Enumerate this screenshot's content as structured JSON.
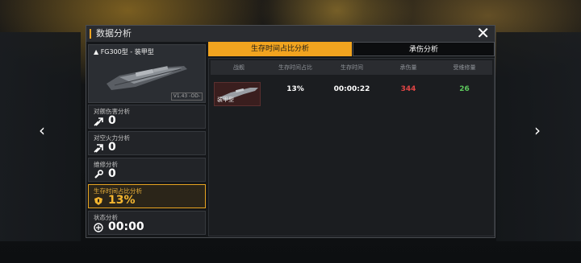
{
  "window": {
    "title": "数据分析"
  },
  "ship": {
    "name": "▲ FG300型 - 装甲型",
    "version": "V1.43 -OD-"
  },
  "stats": [
    {
      "label": "对舰伤害分析",
      "value": "0",
      "icon": "ship-damage-icon"
    },
    {
      "label": "对空火力分析",
      "value": "0",
      "icon": "anti-air-icon"
    },
    {
      "label": "维修分析",
      "value": "0",
      "icon": "wrench-icon"
    },
    {
      "label": "生存时间占比分析",
      "value": "13%",
      "icon": "shield-icon"
    },
    {
      "label": "状态分析",
      "value": "00:00",
      "icon": "status-icon"
    }
  ],
  "tabs": {
    "survival": "生存时间占比分析",
    "damage": "承伤分析"
  },
  "table": {
    "headers": [
      "战舰",
      "生存时间占比",
      "生存时间",
      "承伤量",
      "受维修量"
    ],
    "rows": [
      {
        "ship_label": "装甲型",
        "survival_ratio": "13%",
        "survival_time": "00:00:22",
        "damage_taken": "344",
        "repair": "26"
      }
    ]
  },
  "colors": {
    "accent": "#f5a623",
    "damage": "#e04545",
    "repair": "#5cc75c"
  },
  "nav": {
    "left": "‹",
    "right": "›",
    "close": "✕"
  }
}
